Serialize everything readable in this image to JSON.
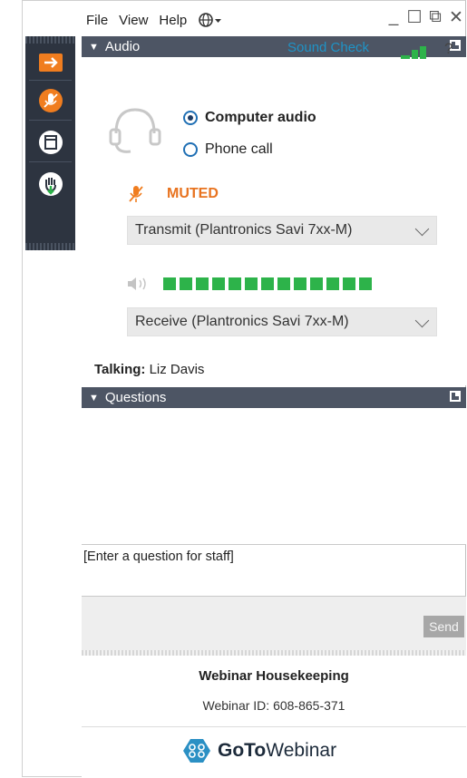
{
  "menu": {
    "file": "File",
    "view": "View",
    "help": "Help",
    "language_icon": "globe-icon"
  },
  "window_controls": {
    "minimize": "_",
    "maximize": "☐",
    "restore": "⧉",
    "close": "✕"
  },
  "sidebar": {
    "items": [
      {
        "name": "collapse-arrow-icon",
        "color": "#f07d1f"
      },
      {
        "name": "mic-muted-icon",
        "color": "#f07d1f"
      },
      {
        "name": "screen-view-icon",
        "color": "#ffffff"
      },
      {
        "name": "raise-hand-icon",
        "color": "#2db34a"
      }
    ]
  },
  "audio": {
    "header": "Audio",
    "sound_check": "Sound Check",
    "help": "?",
    "options": [
      {
        "label": "Computer audio",
        "selected": true
      },
      {
        "label": "Phone call",
        "selected": false
      }
    ],
    "muted_label": "MUTED",
    "transmit": "Transmit (Plantronics Savi 7xx-M)",
    "receive": "Receive (Plantronics Savi 7xx-M)",
    "level_blocks": 13
  },
  "talking": {
    "label": "Talking:",
    "name": "Liz Davis"
  },
  "questions": {
    "header": "Questions",
    "placeholder": "[Enter a question for staff]",
    "send": "Send"
  },
  "footer": {
    "title": "Webinar Housekeeping",
    "webinar_id": "Webinar ID: 608-865-371",
    "logo_goto": "GoTo",
    "logo_webinar": "Webinar"
  },
  "colors": {
    "accent": "#f07d1f",
    "green": "#2db34a",
    "link": "#1f93c6",
    "header_bg": "#4d5564"
  }
}
